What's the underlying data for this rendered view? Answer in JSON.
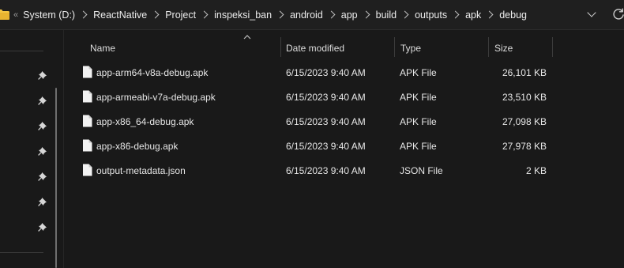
{
  "address_bar": {
    "overflow_glyph": "«",
    "crumbs": [
      "System (D:)",
      "ReactNative",
      "Project",
      "inspeksi_ban",
      "android",
      "app",
      "build",
      "outputs",
      "apk",
      "debug"
    ]
  },
  "columns": {
    "name": "Name",
    "date_modified": "Date modified",
    "type": "Type",
    "size": "Size",
    "sorted_by": "name"
  },
  "files": [
    {
      "name": "app-arm64-v8a-debug.apk",
      "date": "6/15/2023 9:40 AM",
      "type": "APK File",
      "size": "26,101 KB"
    },
    {
      "name": "app-armeabi-v7a-debug.apk",
      "date": "6/15/2023 9:40 AM",
      "type": "APK File",
      "size": "23,510 KB"
    },
    {
      "name": "app-x86_64-debug.apk",
      "date": "6/15/2023 9:40 AM",
      "type": "APK File",
      "size": "27,098 KB"
    },
    {
      "name": "app-x86-debug.apk",
      "date": "6/15/2023 9:40 AM",
      "type": "APK File",
      "size": "27,978 KB"
    },
    {
      "name": "output-metadata.json",
      "date": "6/15/2023 9:40 AM",
      "type": "JSON File",
      "size": "2 KB"
    }
  ],
  "nav_pane": {
    "pinned_count": 7
  },
  "colors": {
    "background": "#191919",
    "text": "#e6e6e6",
    "folder_icon": "#f3c443",
    "divider": "#3c3c3c"
  },
  "icons": {
    "folder": "folder-icon",
    "file": "document-icon",
    "pin": "pin-icon",
    "refresh": "refresh-icon",
    "history_dropdown": "chevron-down-icon"
  }
}
